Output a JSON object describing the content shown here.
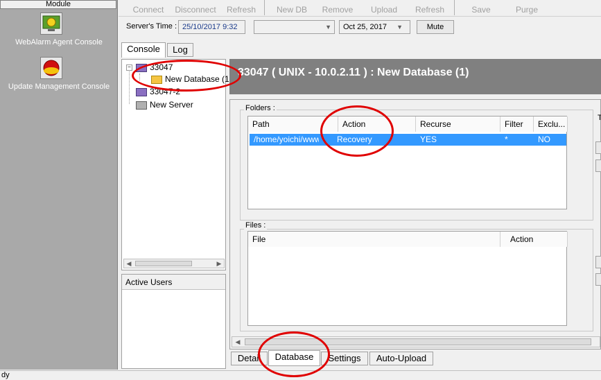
{
  "modules": {
    "header": "Module",
    "items": [
      {
        "label": "WebAlarm Agent Console"
      },
      {
        "label": "Update Management Console"
      }
    ]
  },
  "toolbar": {
    "connect": "Connect",
    "disconnect": "Disconnect",
    "refresh": "Refresh",
    "new_db": "New DB",
    "remove": "Remove",
    "upload": "Upload",
    "refresh2": "Refresh",
    "save": "Save",
    "purge": "Purge"
  },
  "timebar": {
    "server_time_label": "Server's Time :",
    "server_time_value": "25/10/2017  9:32",
    "date_value": "Oct 25, 2017",
    "mute_label": "Mute"
  },
  "left_tabs": {
    "console": "Console",
    "log": "Log"
  },
  "tree": {
    "items": [
      {
        "label": "33047"
      },
      {
        "label": "New Database (1"
      },
      {
        "label": "33047-2"
      },
      {
        "label": "New Server"
      }
    ]
  },
  "active_users": {
    "label": "Active Users"
  },
  "detail": {
    "title": "33047 ( UNIX - 10.0.2.11 )  : New Database (1)"
  },
  "folders": {
    "label": "Folders :",
    "columns": [
      "Path",
      "Action",
      "Recurse",
      "Filter",
      "Exclu..."
    ],
    "rows": [
      {
        "path": "/home/yoichi/www_",
        "action": "Recovery",
        "recurse": "YES",
        "filter": "*",
        "exclude": "NO"
      }
    ],
    "side_label": "T"
  },
  "files": {
    "label": "Files :",
    "columns": [
      "File",
      "Action"
    ]
  },
  "bottom_tabs": {
    "detail": "Detail",
    "database": "Database",
    "settings": "Settings",
    "auto_upload": "Auto-Upload"
  },
  "status": {
    "text": "dy"
  },
  "colors": {
    "selection": "#3399ff",
    "header_bg": "#808080",
    "annotation": "#e00000"
  }
}
